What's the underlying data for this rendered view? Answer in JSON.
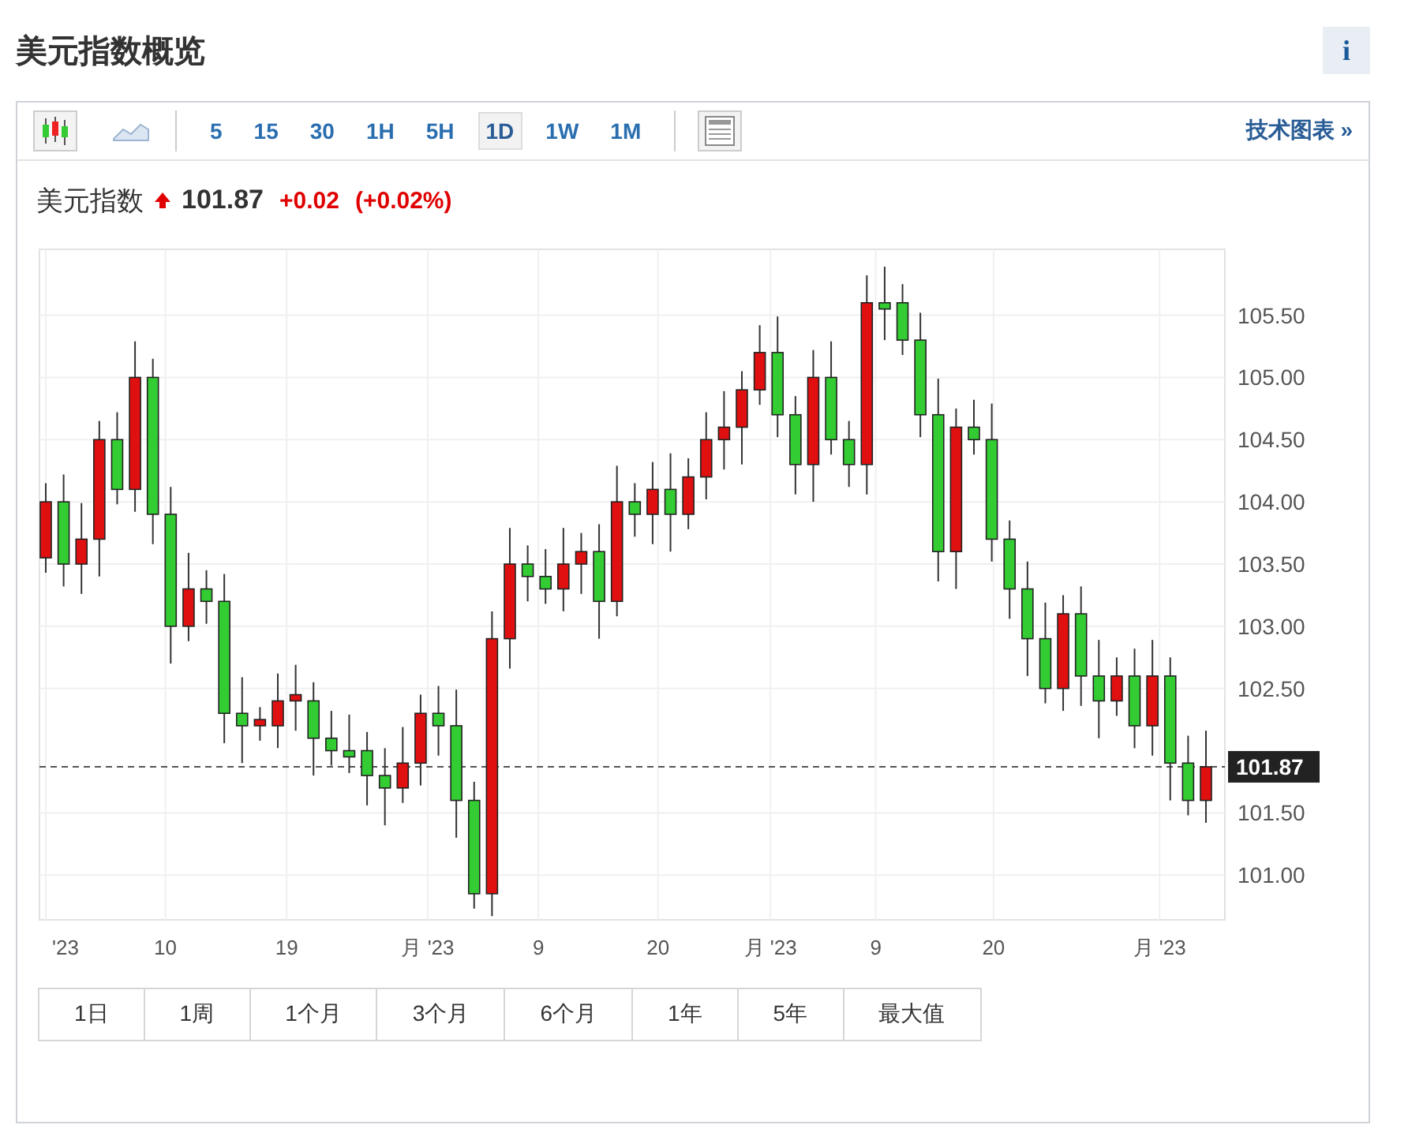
{
  "title": "美元指数概览",
  "info_button": "i",
  "toolbar": {
    "intervals": [
      {
        "label": "5",
        "selected": false
      },
      {
        "label": "15",
        "selected": false
      },
      {
        "label": "30",
        "selected": false
      },
      {
        "label": "1H",
        "selected": false
      },
      {
        "label": "5H",
        "selected": false
      },
      {
        "label": "1D",
        "selected": true
      },
      {
        "label": "1W",
        "selected": false
      },
      {
        "label": "1M",
        "selected": false
      }
    ],
    "link": "技术图表 »"
  },
  "quote": {
    "name": "美元指数",
    "price": "101.87",
    "change": "+0.02",
    "change_percent": "(+0.02%)"
  },
  "chart": {
    "x_axis_labels": [
      "'23",
      "10",
      "19",
      "月 '23",
      "9",
      "20",
      "月 '23",
      "9",
      "20",
      "月 '23"
    ],
    "chart_data": {
      "type": "candlestick",
      "ylim": [
        100.64,
        106.03
      ],
      "grid": true,
      "ref_lines": [
        {
          "axis": "y",
          "value": 101.87,
          "label": "101.87"
        }
      ],
      "yticks": [
        {
          "value": 105.5,
          "label": "105.50"
        },
        {
          "value": 105,
          "label": "105.00"
        },
        {
          "value": 104.5,
          "label": "104.50"
        },
        {
          "value": 104,
          "label": "104.00"
        },
        {
          "value": 103.5,
          "label": "103.50"
        },
        {
          "value": 103,
          "label": "103.00"
        },
        {
          "value": 102.5,
          "label": "102.50"
        },
        {
          "value": 101.5,
          "label": "101.50"
        },
        {
          "value": 101,
          "label": "101.00"
        }
      ],
      "ohlc": [
        [
          103.55,
          104.15,
          103.43,
          104.0
        ],
        [
          104.0,
          104.22,
          103.32,
          103.5
        ],
        [
          103.5,
          103.99,
          103.26,
          103.7
        ],
        [
          103.7,
          104.65,
          103.4,
          104.5
        ],
        [
          104.5,
          104.72,
          103.98,
          104.1
        ],
        [
          104.1,
          105.29,
          103.92,
          105.0
        ],
        [
          105.0,
          105.15,
          103.66,
          103.9
        ],
        [
          103.9,
          104.12,
          102.7,
          103.0
        ],
        [
          103.0,
          103.59,
          102.88,
          103.3
        ],
        [
          103.3,
          103.45,
          103.02,
          103.2
        ],
        [
          103.2,
          103.42,
          102.06,
          102.3
        ],
        [
          102.3,
          102.59,
          101.9,
          102.2
        ],
        [
          102.2,
          102.35,
          102.08,
          102.25
        ],
        [
          102.2,
          102.62,
          102.02,
          102.4
        ],
        [
          102.4,
          102.69,
          102.16,
          102.45
        ],
        [
          102.4,
          102.55,
          101.8,
          102.1
        ],
        [
          102.1,
          102.32,
          101.88,
          102.0
        ],
        [
          102.0,
          102.29,
          101.82,
          101.95
        ],
        [
          102.0,
          102.15,
          101.56,
          101.8
        ],
        [
          101.8,
          102.02,
          101.4,
          101.7
        ],
        [
          101.7,
          102.19,
          101.58,
          101.9
        ],
        [
          101.9,
          102.45,
          101.72,
          102.3
        ],
        [
          102.3,
          102.52,
          101.96,
          102.2
        ],
        [
          102.2,
          102.49,
          101.3,
          101.6
        ],
        [
          101.6,
          101.75,
          100.73,
          100.85
        ],
        [
          100.85,
          103.12,
          100.67,
          102.9
        ],
        [
          102.9,
          103.79,
          102.66,
          103.5
        ],
        [
          103.5,
          103.65,
          103.2,
          103.4
        ],
        [
          103.4,
          103.62,
          103.18,
          103.3
        ],
        [
          103.3,
          103.79,
          103.12,
          103.5
        ],
        [
          103.5,
          103.75,
          103.26,
          103.6
        ],
        [
          103.6,
          103.82,
          102.9,
          103.2
        ],
        [
          103.2,
          104.29,
          103.08,
          104.0
        ],
        [
          104.0,
          104.15,
          103.72,
          103.9
        ],
        [
          103.9,
          104.32,
          103.66,
          104.1
        ],
        [
          104.1,
          104.39,
          103.6,
          103.9
        ],
        [
          103.9,
          104.35,
          103.78,
          104.2
        ],
        [
          104.2,
          104.72,
          104.02,
          104.5
        ],
        [
          104.5,
          104.89,
          104.26,
          104.6
        ],
        [
          104.6,
          105.05,
          104.3,
          104.9
        ],
        [
          104.9,
          105.42,
          104.78,
          105.2
        ],
        [
          105.2,
          105.49,
          104.52,
          104.7
        ],
        [
          104.7,
          104.85,
          104.06,
          104.3
        ],
        [
          104.3,
          105.22,
          104.0,
          105.0
        ],
        [
          105.0,
          105.29,
          104.38,
          104.5
        ],
        [
          104.5,
          104.65,
          104.12,
          104.3
        ],
        [
          104.3,
          105.82,
          104.06,
          105.6
        ],
        [
          105.6,
          105.89,
          105.3,
          105.55
        ],
        [
          105.6,
          105.75,
          105.18,
          105.3
        ],
        [
          105.3,
          105.52,
          104.52,
          104.7
        ],
        [
          104.7,
          104.99,
          103.36,
          103.6
        ],
        [
          103.6,
          104.75,
          103.3,
          104.6
        ],
        [
          104.6,
          104.82,
          104.38,
          104.5
        ],
        [
          104.5,
          104.79,
          103.52,
          103.7
        ],
        [
          103.7,
          103.85,
          103.06,
          103.3
        ],
        [
          103.3,
          103.52,
          102.6,
          102.9
        ],
        [
          102.9,
          103.19,
          102.38,
          102.5
        ],
        [
          102.5,
          103.25,
          102.32,
          103.1
        ],
        [
          103.1,
          103.32,
          102.36,
          102.6
        ],
        [
          102.6,
          102.89,
          102.1,
          102.4
        ],
        [
          102.4,
          102.75,
          102.28,
          102.6
        ],
        [
          102.6,
          102.82,
          102.02,
          102.2
        ],
        [
          102.2,
          102.89,
          101.96,
          102.6
        ],
        [
          102.6,
          102.75,
          101.6,
          101.9
        ],
        [
          101.9,
          102.12,
          101.48,
          101.6
        ],
        [
          101.6,
          102.16,
          101.42,
          101.87
        ]
      ]
    }
  },
  "ranges": [
    {
      "label": "1日"
    },
    {
      "label": "1周"
    },
    {
      "label": "1个月"
    },
    {
      "label": "3个月"
    },
    {
      "label": "6个月"
    },
    {
      "label": "1年"
    },
    {
      "label": "5年"
    },
    {
      "label": "最大值"
    }
  ]
}
